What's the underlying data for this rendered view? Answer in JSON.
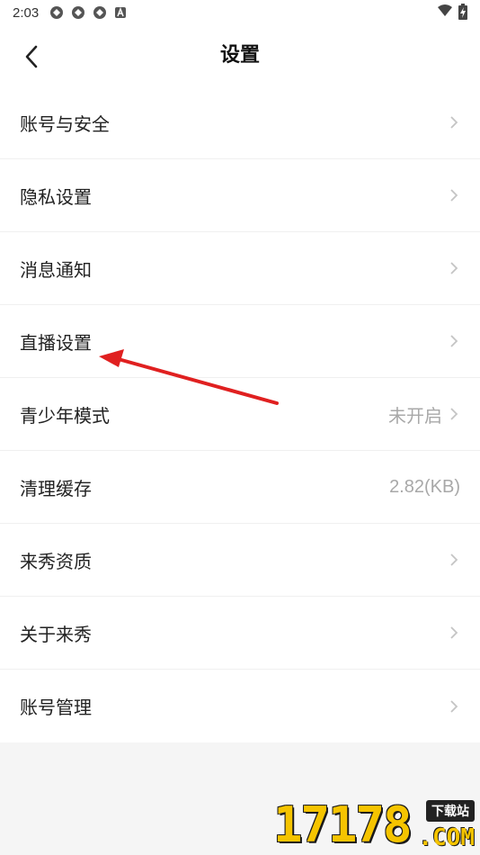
{
  "status_bar": {
    "time": "2:03",
    "left_icons": [
      "app-notification-icon",
      "app-notification-icon",
      "app-notification-icon",
      "a-notification-icon"
    ],
    "right_icons": [
      "wifi-icon",
      "battery-charging-icon"
    ]
  },
  "header": {
    "title": "设置",
    "back_icon": "chevron-left-icon"
  },
  "settings": {
    "items": [
      {
        "label": "账号与安全",
        "value": "",
        "chevron": true
      },
      {
        "label": "隐私设置",
        "value": "",
        "chevron": true
      },
      {
        "label": "消息通知",
        "value": "",
        "chevron": true
      },
      {
        "label": "直播设置",
        "value": "",
        "chevron": true
      },
      {
        "label": "青少年模式",
        "value": "未开启",
        "chevron": true
      },
      {
        "label": "清理缓存",
        "value": "2.82(KB)",
        "chevron": false
      },
      {
        "label": "来秀资质",
        "value": "",
        "chevron": true
      },
      {
        "label": "关于来秀",
        "value": "",
        "chevron": true
      },
      {
        "label": "账号管理",
        "value": "",
        "chevron": true
      }
    ]
  },
  "annotation": {
    "arrow_color": "#e02020"
  },
  "watermark": {
    "digits": "17178",
    "tag": "下载站",
    "suffix": ".COM"
  },
  "colors": {
    "background": "#f5f5f5",
    "surface": "#ffffff",
    "text": "#222222",
    "secondary_text": "#a8a8a8",
    "chevron": "#c4c4c4",
    "watermark_yellow": "#f5c400"
  }
}
